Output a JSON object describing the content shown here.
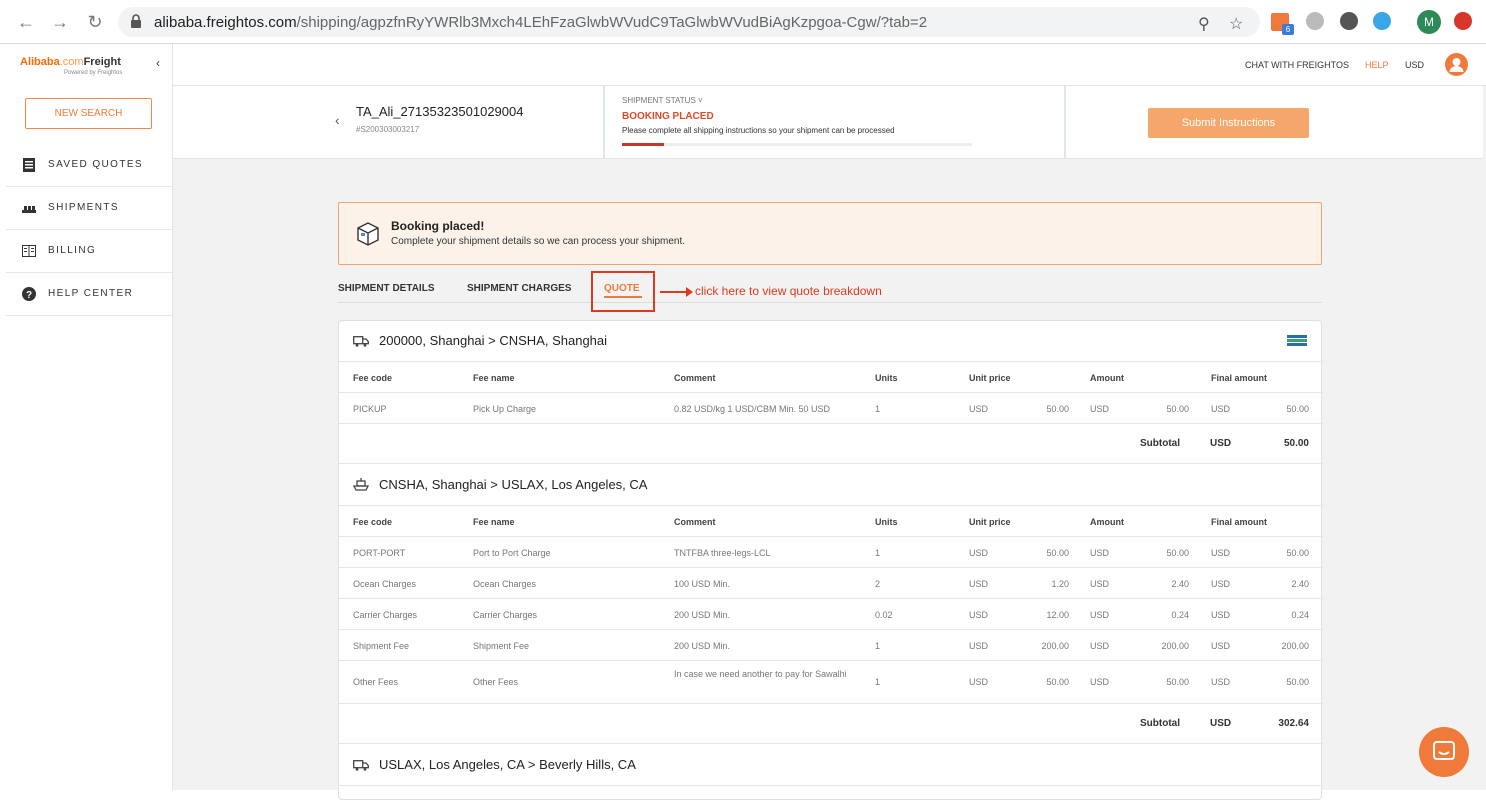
{
  "browser": {
    "url_host": "alibaba.freightos.com",
    "url_path": "/shipping/agpzfnRyYWRlb3Mxch4LEhFzaGlwbWVudC9TaGlwbWVudBiAgKzpgoa-Cgw/?tab=2",
    "ext_badge": "6",
    "profile_initial": "M",
    "icons": [
      "back-icon",
      "forward-icon",
      "reload-icon",
      "lock-icon",
      "zoom-icon",
      "star-icon"
    ]
  },
  "sidebar": {
    "logo_brand": "Alibaba",
    "logo_com": ".com",
    "logo_product": "Freight",
    "logo_sub": "Powered by Freightos",
    "collapse": "‹",
    "new_search": "NEW SEARCH",
    "items": [
      {
        "label": "SAVED QUOTES",
        "icon": "saved-quotes-icon"
      },
      {
        "label": "SHIPMENTS",
        "icon": "shipments-icon"
      },
      {
        "label": "BILLING",
        "icon": "billing-icon"
      },
      {
        "label": "HELP CENTER",
        "icon": "help-icon"
      }
    ]
  },
  "topbar": {
    "chat": "CHAT WITH FREIGHTOS",
    "help": "HELP",
    "currency": "USD",
    "accent": "#f07a3a"
  },
  "header": {
    "back": "‹",
    "shipment_id": "TA_Ali_27135323501029004",
    "shipment_ref": "#S200303003217",
    "status_label": "SHIPMENT STATUS ˅",
    "status_value": "BOOKING PLACED",
    "status_message": "Please complete all shipping instructions so your shipment can be processed",
    "progress_fraction": 0.12,
    "submit": "Submit Instructions"
  },
  "banner": {
    "title": "Booking placed!",
    "message": "Complete your shipment details so we can process your shipment."
  },
  "tabs": [
    {
      "label": "SHIPMENT DETAILS"
    },
    {
      "label": "SHIPMENT CHARGES"
    },
    {
      "label": "QUOTE",
      "active": true
    }
  ],
  "annotation": "click here to view quote breakdown",
  "columns": [
    "Fee code",
    "Fee name",
    "Comment",
    "Units",
    "Unit price",
    "Amount",
    "Final amount"
  ],
  "legs": [
    {
      "title": "200000, Shanghai > CNSHA, Shanghai",
      "icon": "truck-icon",
      "rows": [
        [
          "PICKUP",
          "Pick Up Charge",
          "0.82 USD/kg 1 USD/CBM Min. 50 USD",
          "1",
          "USD",
          "50.00",
          "USD",
          "50.00",
          "USD",
          "50.00"
        ]
      ],
      "subtotal_label": "Subtotal",
      "subtotal_currency": "USD",
      "subtotal": "50.00"
    },
    {
      "title": "CNSHA, Shanghai > USLAX, Los Angeles, CA",
      "icon": "ship-icon",
      "rows": [
        [
          "PORT-PORT",
          "Port to Port Charge",
          "TNTFBA three-legs-LCL",
          "1",
          "USD",
          "50.00",
          "USD",
          "50.00",
          "USD",
          "50.00"
        ],
        [
          "Ocean Charges",
          "Ocean Charges",
          "100 USD Min.",
          "2",
          "USD",
          "1.20",
          "USD",
          "2.40",
          "USD",
          "2.40"
        ],
        [
          "Carrier Charges",
          "Carrier Charges",
          "200 USD Min.",
          "0.02",
          "USD",
          "12.00",
          "USD",
          "0.24",
          "USD",
          "0.24"
        ],
        [
          "Shipment Fee",
          "Shipment Fee",
          "200 USD Min.",
          "1",
          "USD",
          "200.00",
          "USD",
          "200.00",
          "USD",
          "200.00"
        ],
        [
          "Other Fees",
          "Other Fees",
          "In case we need another to pay for Sawalhi",
          "1",
          "USD",
          "50.00",
          "USD",
          "50.00",
          "USD",
          "50.00"
        ]
      ],
      "subtotal_label": "Subtotal",
      "subtotal_currency": "USD",
      "subtotal": "302.64"
    },
    {
      "title": "USLAX, Los Angeles, CA > Beverly Hills, CA",
      "icon": "truck-icon"
    }
  ]
}
